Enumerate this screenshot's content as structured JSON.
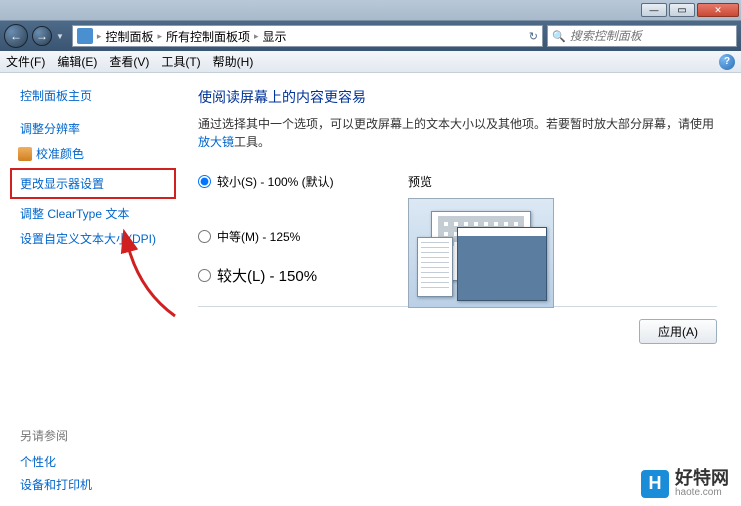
{
  "titlebar": {
    "min": "—",
    "max": "▭",
    "close": "✕"
  },
  "nav": {
    "back": "←",
    "fwd": "→",
    "dd": "▼",
    "addr_part1": "控制面板",
    "sep": "▸",
    "addr_part2": "所有控制面板项",
    "addr_part3": "显示",
    "refresh": "↻",
    "search_placeholder": "搜索控制面板",
    "search_icon": "🔍"
  },
  "menu": {
    "file": "文件(F)",
    "edit": "编辑(E)",
    "view": "查看(V)",
    "tools": "工具(T)",
    "help": "帮助(H)",
    "qmark": "?"
  },
  "sidebar": {
    "home": "控制面板主页",
    "res": "调整分辨率",
    "color": "校准颜色",
    "display_settings": "更改显示器设置",
    "cleartype": "调整 ClearType 文本",
    "dpi": "设置自定义文本大小(DPI)",
    "see_also": "另请参阅",
    "personalize": "个性化",
    "devices": "设备和打印机"
  },
  "main": {
    "title": "使阅读屏幕上的内容更容易",
    "desc_before": "通过选择其中一个选项，可以更改屏幕上的文本大小以及其他项。若要暂时放大部分屏幕，请使用",
    "magnifier": "放大镜",
    "desc_after": "工具。",
    "opt_small": "较小(S) - 100% (默认)",
    "opt_medium": "中等(M) - 125%",
    "opt_large": "较大(L) - 150%",
    "preview": "预览",
    "apply": "应用(A)"
  },
  "watermark": {
    "logo": "H",
    "name": "好特网",
    "url": "haote.com"
  }
}
